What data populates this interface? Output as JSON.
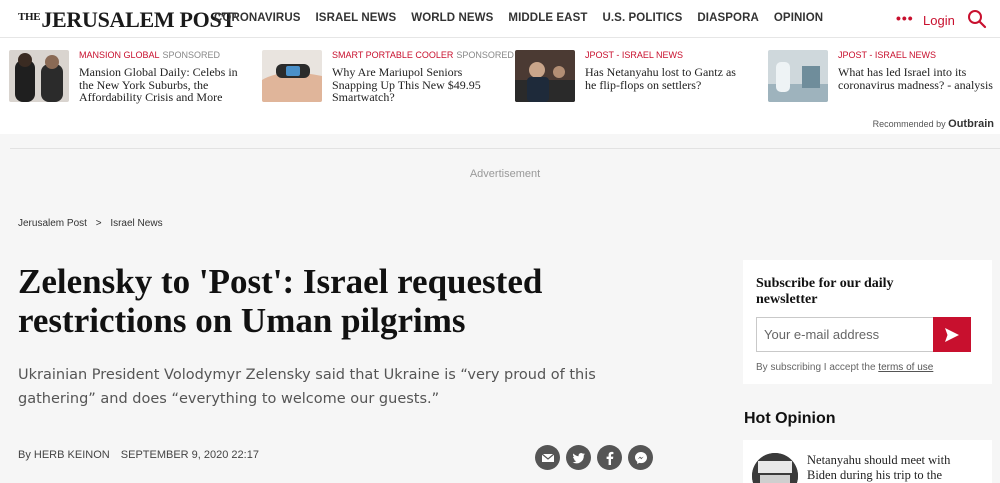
{
  "header": {
    "logo_the": "THE",
    "logo_text": "JERUSALEM POST",
    "nav": [
      "CORONAVIRUS",
      "ISRAEL NEWS",
      "WORLD NEWS",
      "MIDDLE EAST",
      "U.S. POLITICS",
      "DIASPORA",
      "OPINION"
    ],
    "more_label": "•••",
    "login_label": "Login",
    "search_icon": "search-icon",
    "accent_color": "#c8102e"
  },
  "recommended": {
    "items": [
      {
        "source": "MANSION GLOBAL",
        "sponsored": "SPONSORED",
        "title": "Mansion Global Daily: Celebs in the New York Suburbs, the Affordability Crisis and More"
      },
      {
        "source": "SMART PORTABLE COOLER",
        "sponsored": "SPONSORED",
        "title": "Why Are Mariupol Seniors Snapping Up This New $49.95 Smartwatch?"
      },
      {
        "source": "JPOST - ISRAEL NEWS",
        "sponsored": "",
        "title": "Has Netanyahu lost to Gantz as he flip-flops on settlers?"
      },
      {
        "source": "JPOST - ISRAEL NEWS",
        "sponsored": "",
        "title": "What has led Israel into its coronavirus madness? - analysis"
      }
    ],
    "recommended_by": "Recommended by",
    "provider": "Outbrain"
  },
  "ad_label": "Advertisement",
  "breadcrumb": {
    "root": "Jerusalem Post",
    "separator": ">",
    "section": "Israel News"
  },
  "article": {
    "headline": "Zelensky to 'Post': Israel requested restrictions on Uman pilgrims",
    "subheadline": "Ukrainian President Volodymyr Zelensky said that Ukraine is “very proud of this gathering” and does “everything to welcome our guests.”",
    "by_prefix": "By",
    "author": "HERB KEINON",
    "date": "SEPTEMBER 9, 2020 22:17",
    "share_icons": [
      "email-icon",
      "twitter-icon",
      "facebook-icon",
      "messenger-icon"
    ]
  },
  "newsletter": {
    "title": "Subscribe for our daily newsletter",
    "email_placeholder": "Your e-mail address",
    "terms_prefix": "By subscribing I accept the",
    "terms_link": "terms of use"
  },
  "hot_opinion": {
    "title": "Hot Opinion",
    "items": [
      {
        "text": "Netanyahu should meet with Biden during his trip to the"
      }
    ]
  }
}
